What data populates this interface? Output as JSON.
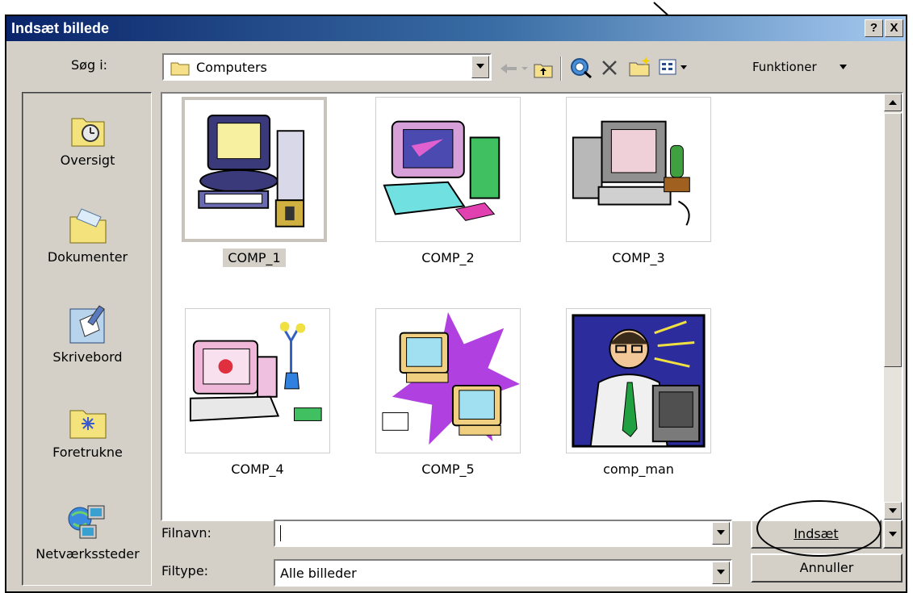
{
  "dialog": {
    "title": "Indsæt billede",
    "help_label": "?",
    "close_label": "X"
  },
  "toolbar": {
    "look_in_label": "Søg i:",
    "folder_value": "Computers",
    "tools_label": "Funktioner"
  },
  "places": [
    {
      "label": "Oversigt"
    },
    {
      "label": "Dokumenter"
    },
    {
      "label": "Skrivebord"
    },
    {
      "label": "Foretrukne"
    },
    {
      "label": "Netværkssteder"
    }
  ],
  "files": [
    {
      "name": "COMP_1",
      "selected": true
    },
    {
      "name": "COMP_2"
    },
    {
      "name": "COMP_3"
    },
    {
      "name": "COMP_4"
    },
    {
      "name": "COMP_5"
    },
    {
      "name": "comp_man"
    }
  ],
  "filename": {
    "label": "Filnavn:",
    "value": ""
  },
  "filetype": {
    "label": "Filtype:",
    "value": "Alle billeder"
  },
  "buttons": {
    "insert": "Indsæt",
    "cancel": "Annuller"
  },
  "colors": {
    "title_start": "#0a246a",
    "title_end": "#a6caf0",
    "face": "#d4d0c8"
  }
}
